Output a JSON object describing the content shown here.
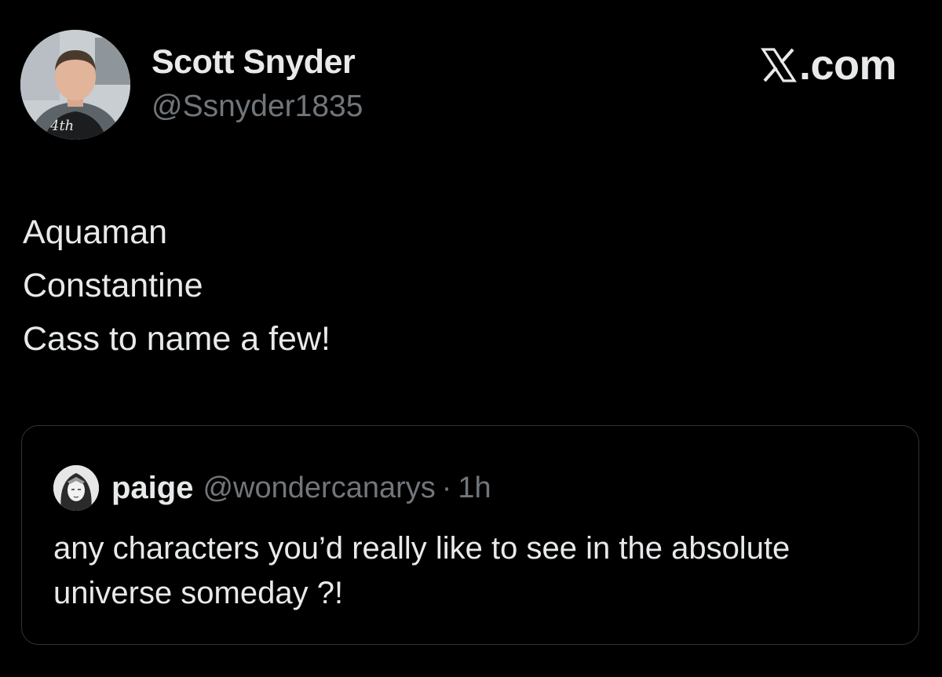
{
  "author": {
    "name": "Scott Snyder",
    "handle": "@Ssnyder1835",
    "avatar_icon": "profile-photo-icon"
  },
  "brand": {
    "label": ".com",
    "icon": "x-logo-icon"
  },
  "tweet": {
    "lines": [
      "Aquaman",
      "Constantine",
      "Cass to name a few!"
    ]
  },
  "quote": {
    "avatar_icon": "profile-illustration-icon",
    "name": "paige",
    "handle": "@wondercanarys",
    "separator": "·",
    "time": "1h",
    "text": "any characters you’d really like to see in the absolute universe someday ?!"
  },
  "colors": {
    "background": "#000000",
    "primary_text": "#e7e9ea",
    "secondary_text": "#71767b",
    "border": "#2f3336"
  }
}
